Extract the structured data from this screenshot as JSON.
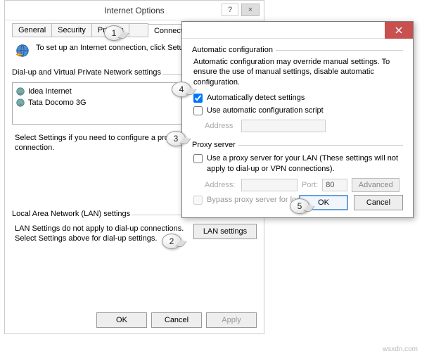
{
  "io": {
    "title": "Internet Options",
    "help": "?",
    "close": "×",
    "tabs": [
      "General",
      "Security",
      "Privacy",
      "",
      "Connections"
    ],
    "setup_text": "To set up an Internet connection, click Setup.",
    "dialup_label": "Dial-up and Virtual Private Network settings",
    "connections": [
      "Idea Internet",
      "Tata Docomo 3G"
    ],
    "hint": "Select Settings if you need to configure a proxy server for a connection.",
    "lan_label": "Local Area Network (LAN) settings",
    "lan_text": "LAN Settings do not apply to dial-up connections. Select Settings above for dial-up settings.",
    "lan_btn": "LAN settings",
    "ok": "OK",
    "cancel": "Cancel",
    "apply": "Apply"
  },
  "lan": {
    "close": "×",
    "auto_label": "Automatic configuration",
    "auto_desc": "Automatic configuration may override manual settings.  To ensure the use of manual settings, disable automatic configuration.",
    "auto_detect": "Automatically detect settings",
    "auto_script": "Use automatic configuration script",
    "address_lbl": "Address",
    "proxy_label": "Proxy server",
    "proxy_use": "Use a proxy server for your LAN (These settings will not apply to dial-up or VPN connections).",
    "addr_lbl": "Address:",
    "port_lbl": "Port:",
    "port_val": "80",
    "advanced": "Advanced",
    "bypass": "Bypass proxy server for local addresses",
    "ok": "OK",
    "cancel": "Cancel"
  },
  "callouts": {
    "c1": "1",
    "c2": "2",
    "c3": "3",
    "c4": "4",
    "c5": "5"
  },
  "watermark": "wsxdn.com"
}
